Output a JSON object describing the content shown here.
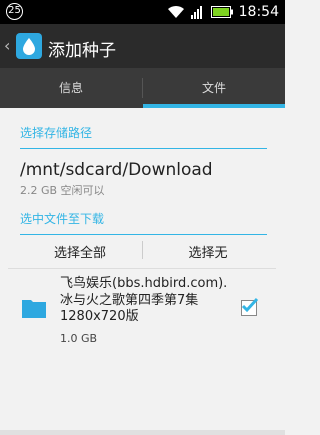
{
  "status_bar": {
    "notification_count": "25",
    "time": "18:54",
    "icons": [
      "wifi-icon",
      "signal-icon",
      "battery-icon"
    ]
  },
  "action_bar": {
    "title": "添加种子"
  },
  "tabs": [
    {
      "label": "信息",
      "selected": false
    },
    {
      "label": "文件",
      "selected": true
    }
  ],
  "storage": {
    "section_title": "选择存储路径",
    "path": "/mnt/sdcard/Download",
    "free_space": "2.2 GB 空闲可以"
  },
  "files": {
    "section_title": "选中文件至下载",
    "select_all": "选择全部",
    "select_none": "选择无",
    "items": [
      {
        "name": "飞鸟娱乐(bbs.hdbird.com).冰与火之歌第四季第7集1280x720版",
        "size": "1.0 GB",
        "checked": true
      }
    ]
  },
  "colors": {
    "accent": "#33b5e5",
    "action_bar": "#2b2b2b",
    "tab_bar": "#3a3a3a"
  }
}
